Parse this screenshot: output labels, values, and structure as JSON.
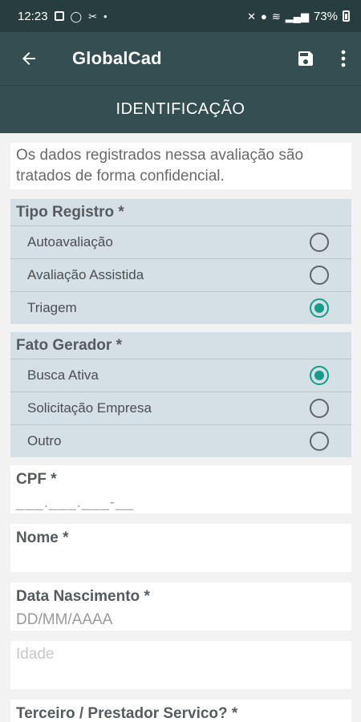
{
  "status_bar": {
    "time": "12:23",
    "dot": "•",
    "battery": "73%"
  },
  "app_bar": {
    "title": "GlobalCad"
  },
  "section": {
    "title": "IDENTIFICAÇÃO"
  },
  "notice": {
    "text": "Os dados registrados nessa avaliação são tratados de forma confidencial."
  },
  "tipo_registro": {
    "title": "Tipo Registro *",
    "options": [
      {
        "label": "Autoavaliação",
        "checked": false
      },
      {
        "label": "Avaliação Assistida",
        "checked": false
      },
      {
        "label": "Triagem",
        "checked": true
      }
    ]
  },
  "fato_gerador": {
    "title": "Fato Gerador *",
    "options": [
      {
        "label": "Busca Ativa",
        "checked": true
      },
      {
        "label": "Solicitação Empresa",
        "checked": false
      },
      {
        "label": "Outro",
        "checked": false
      }
    ]
  },
  "cpf": {
    "label": "CPF *",
    "mask": "___.___.___-__"
  },
  "nome": {
    "label": "Nome *",
    "value": ""
  },
  "data_nascimento": {
    "label": "Data Nascimento *",
    "placeholder": "DD/MM/AAAA"
  },
  "idade": {
    "placeholder": "Idade"
  },
  "terceiro": {
    "label": "Terceiro / Prestador Servico? *"
  },
  "colors": {
    "app_bar": "#354e52",
    "status_bar": "#283d3f",
    "group_bg": "#d4e0e5",
    "radio_checked": "#169c8a"
  }
}
